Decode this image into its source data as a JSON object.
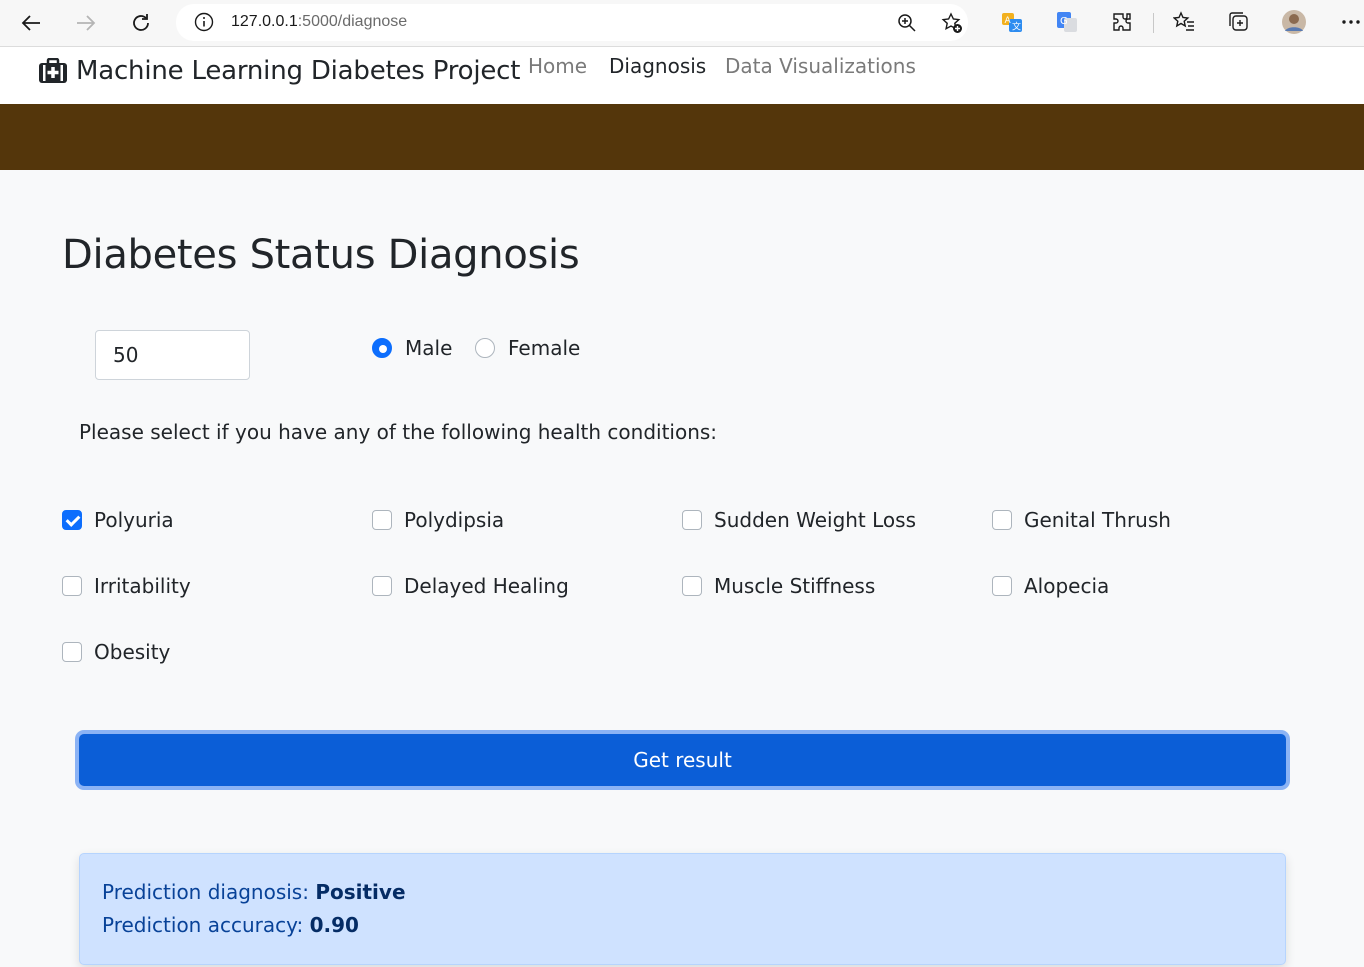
{
  "browser": {
    "url_host": "127.0.0.1",
    "url_path": ":5000/diagnose"
  },
  "navbar": {
    "brand": "Machine Learning Diabetes Project",
    "links": [
      {
        "label": "Home",
        "active": false
      },
      {
        "label": "Diagnosis",
        "active": true
      },
      {
        "label": "Data Visualizations",
        "active": false
      }
    ]
  },
  "colors": {
    "hero_strip": "#54360b",
    "primary": "#0b5ed7",
    "alert_bg": "#cfe2ff"
  },
  "form": {
    "title": "Diabetes Status Diagnosis",
    "age_value": "50",
    "gender": {
      "options": [
        {
          "label": "Male",
          "checked": true
        },
        {
          "label": "Female",
          "checked": false
        }
      ]
    },
    "prompt": "Please select if you have any of the following health conditions:",
    "conditions": [
      {
        "label": "Polyuria",
        "checked": true
      },
      {
        "label": "Polydipsia",
        "checked": false
      },
      {
        "label": "Sudden Weight Loss",
        "checked": false
      },
      {
        "label": "Genital Thrush",
        "checked": false
      },
      {
        "label": "Irritability",
        "checked": false
      },
      {
        "label": "Delayed Healing",
        "checked": false
      },
      {
        "label": "Muscle Stiffness",
        "checked": false
      },
      {
        "label": "Alopecia",
        "checked": false
      },
      {
        "label": "Obesity",
        "checked": false
      }
    ],
    "submit_label": "Get result"
  },
  "result": {
    "diagnosis_label": "Prediction diagnosis: ",
    "diagnosis_value": "Positive",
    "accuracy_label": "Prediction accuracy: ",
    "accuracy_value": "0.90"
  }
}
